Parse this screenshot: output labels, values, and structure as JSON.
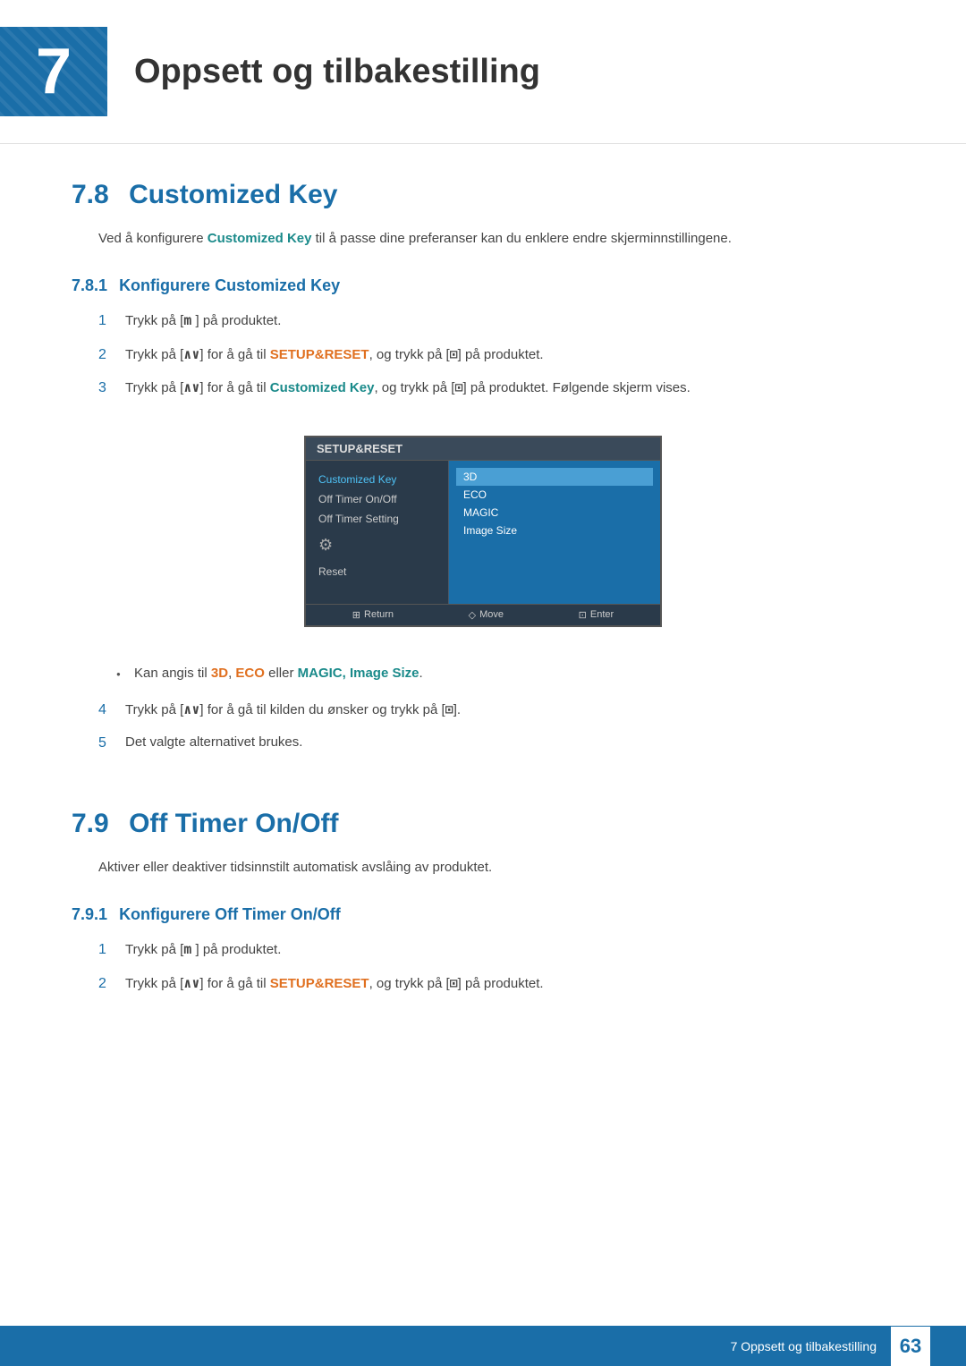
{
  "chapter": {
    "number": "7",
    "title": "Oppsett og tilbakestilling"
  },
  "section_78": {
    "number": "7.8",
    "title": "Customized Key",
    "intro_text": "Ved å konfigurere ",
    "intro_bold": "Customized Key",
    "intro_rest": " til å passe dine preferanser kan du enklere endre skjerminnstillingene.",
    "subsection_781": {
      "number": "7.8.1",
      "title": "Konfigurere Customized Key",
      "steps": [
        {
          "num": "1",
          "text": "Trykk på [",
          "key": "m",
          "text2": " ] på produktet."
        },
        {
          "num": "2",
          "text": "Trykk på [",
          "key": "∧∨",
          "text2": "] for å gå til ",
          "bold": "SETUP&RESET",
          "text3": ", og trykk på [",
          "icon": "⊡",
          "text4": "] på produktet."
        },
        {
          "num": "3",
          "text": "Trykk på [",
          "key": "∧∨",
          "text2": "] for å gå til ",
          "bold": "Customized Key",
          "text3": ", og trykk på [",
          "icon": "⊡",
          "text4": "] på produktet. Følgende skjerm vises."
        }
      ],
      "monitor": {
        "title": "SETUP&RESET",
        "menu_items": [
          "Customized Key",
          "Off Timer On/Off",
          "Off Timer Setting",
          "Reset"
        ],
        "active_item": "Customized Key",
        "submenu_items": [
          "3D",
          "ECO",
          "MAGIC",
          "Image Size"
        ],
        "active_submenu": "3D",
        "footer": [
          "⊞ Return",
          "◇ Move",
          "⊡ Enter"
        ]
      },
      "bullet_text_pre": "Kan angis til ",
      "bullet_bold1": "3D",
      "bullet_sep1": ", ",
      "bullet_bold2": "ECO",
      "bullet_sep2": " eller ",
      "bullet_bold3": "MAGIC, Image Size",
      "bullet_end": ".",
      "step4": {
        "num": "4",
        "text": "Trykk på [",
        "key": "∧∨",
        "text2": "] for å gå til kilden du ønsker og trykk på [",
        "icon": "⊡",
        "text3": "]."
      },
      "step5": {
        "num": "5",
        "text": "Det valgte alternativet brukes."
      }
    }
  },
  "section_79": {
    "number": "7.9",
    "title": "Off Timer On/Off",
    "intro_text": "Aktiver eller deaktiver tidsinnstilt automatisk avslåing av produktet.",
    "subsection_791": {
      "number": "7.9.1",
      "title": "Konfigurere Off Timer On/Off",
      "steps": [
        {
          "num": "1",
          "text": "Trykk på [",
          "key": "m",
          "text2": " ] på produktet."
        },
        {
          "num": "2",
          "text": "Trykk på [",
          "key": "∧∨",
          "text2": "] for å gå til ",
          "bold": "SETUP&RESET",
          "text3": ", og trykk på [",
          "icon": "⊡",
          "text4": "] på produktet."
        }
      ]
    }
  },
  "footer": {
    "text": "7 Oppsett og tilbakestilling",
    "page": "63"
  }
}
